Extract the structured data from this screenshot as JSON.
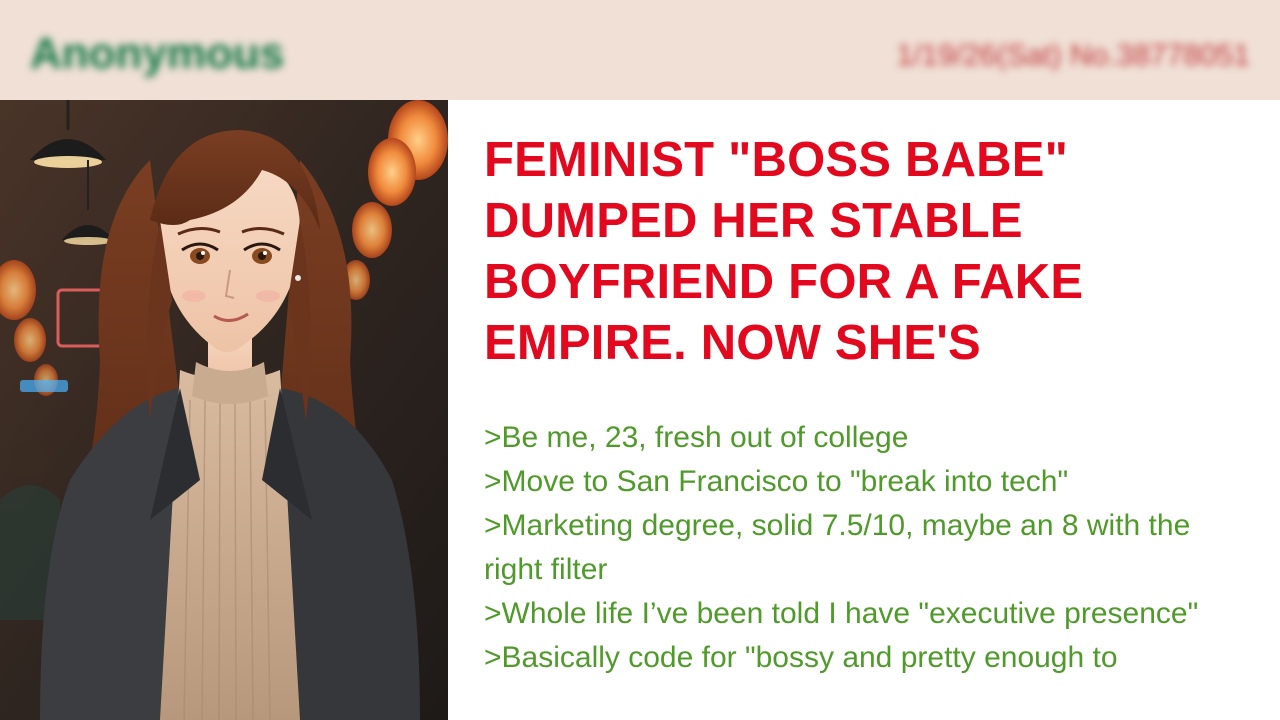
{
  "header": {
    "poster_name": "Anonymous",
    "post_meta": "1/19/26(Sat) No.38778051"
  },
  "illustration": {
    "subject": "anime-style woman with long auburn hair in beige turtleneck and dark blazer, bar background with lanterns"
  },
  "post": {
    "title": "FEMINIST \"BOSS BABE\" DUMPED HER STABLE BOYFRIEND FOR A FAKE EMPIRE. NOW SHE'S",
    "lines": [
      ">Be me, 23, fresh out of college",
      ">Move to San Francisco to \"break into tech\"",
      ">Marketing degree, solid 7.5/10, maybe an 8 with the right filter",
      ">Whole life I’ve been told I have \"executive presence\"",
      ">Basically code for \"bossy and pretty enough to"
    ]
  },
  "colors": {
    "header_bg": "#f0e0d6",
    "name_green": "#117743",
    "meta_red": "#c0393b",
    "title_red": "#e2091f",
    "greentext": "#4f9a2a"
  }
}
